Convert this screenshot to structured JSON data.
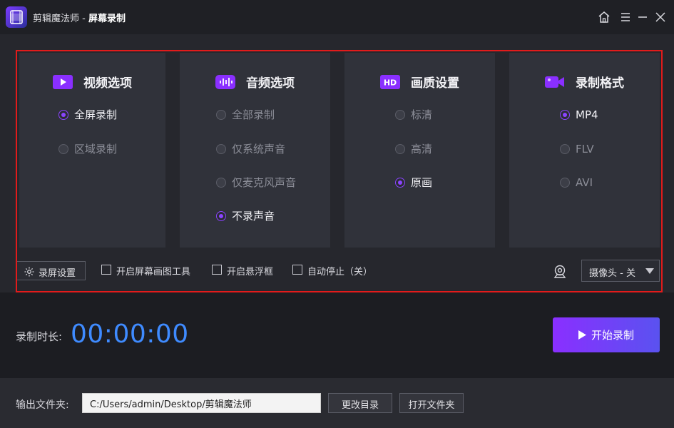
{
  "app": {
    "name": "剪辑魔法师",
    "separator": " - ",
    "title": "屏幕录制"
  },
  "colors": {
    "accent": "#8a44ff",
    "time": "#3f8bff",
    "highlight": "#e21b1b"
  },
  "panels": [
    {
      "title": "视频选项",
      "icon": "video-play-icon",
      "options": [
        {
          "label": "全屏录制",
          "selected": true
        },
        {
          "label": "区域录制",
          "selected": false
        }
      ]
    },
    {
      "title": "音频选项",
      "icon": "audio-wave-icon",
      "options": [
        {
          "label": "全部录制",
          "selected": false
        },
        {
          "label": "仅系统声音",
          "selected": false
        },
        {
          "label": "仅麦克风声音",
          "selected": false
        },
        {
          "label": "不录声音",
          "selected": true
        }
      ]
    },
    {
      "title": "画质设置",
      "icon": "hd-icon",
      "icon_text": "HD",
      "options": [
        {
          "label": "标清",
          "selected": false
        },
        {
          "label": "高清",
          "selected": false
        },
        {
          "label": "原画",
          "selected": true
        }
      ]
    },
    {
      "title": "录制格式",
      "icon": "camera-icon",
      "options": [
        {
          "label": "MP4",
          "selected": true
        },
        {
          "label": "FLV",
          "selected": false
        },
        {
          "label": "AVI",
          "selected": false
        }
      ]
    }
  ],
  "toolbar": {
    "settings_label": "录屏设置",
    "checkboxes": [
      {
        "label": "开启屏幕画图工具",
        "checked": false
      },
      {
        "label": "开启悬浮框",
        "checked": false
      },
      {
        "label": "自动停止（关）",
        "checked": false
      }
    ],
    "camera_label": "摄像头 - 关"
  },
  "recording": {
    "duration_label": "录制时长:",
    "duration": "00:00:00",
    "start_label": "开始录制"
  },
  "footer": {
    "output_label": "输出文件夹:",
    "output_path": "C:/Users/admin/Desktop/剪辑魔法师",
    "change_label": "更改目录",
    "open_label": "打开文件夹"
  }
}
